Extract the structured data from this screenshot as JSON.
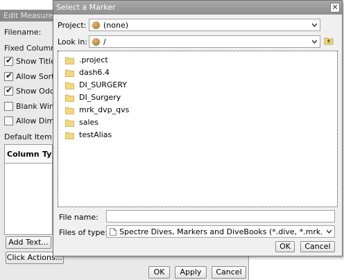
{
  "background_dialog": {
    "title": "Edit Measure",
    "filename_label": "Filename:",
    "fixed_columns_label": "Fixed Column",
    "options": [
      {
        "label": "Show Title",
        "checked": true
      },
      {
        "label": "Allow Sort",
        "checked": true
      },
      {
        "label": "Show Odd",
        "checked": true
      },
      {
        "label": "Blank Win",
        "checked": false
      },
      {
        "label": "Allow Dim",
        "checked": false
      }
    ],
    "default_item_label": "Default Item",
    "grid_columns": [
      "Column",
      "Ty"
    ],
    "add_text_button": "Add Text...",
    "click_actions_button": "Click Actions...",
    "ok_button": "OK",
    "apply_button": "Apply",
    "cancel_button": "Cancel"
  },
  "dialog": {
    "title": "Select a Marker",
    "project_label": "Project:",
    "project_value": "(none)",
    "look_in_label": "Look in:",
    "look_in_value": "/",
    "items": [
      ".project",
      "dash6.4",
      "DI_SURGERY",
      "DI_Surgery",
      "mrk_dvp_qvs",
      "sales",
      "testAlias"
    ],
    "file_name_label": "File name:",
    "file_name_value": "",
    "files_of_type_label": "Files of type:",
    "files_of_type_value": "Spectre Dives, Markers and DiveBooks (*.dive, *.mrk, *.d",
    "ok_button": "OK",
    "cancel_button": "Cancel"
  }
}
